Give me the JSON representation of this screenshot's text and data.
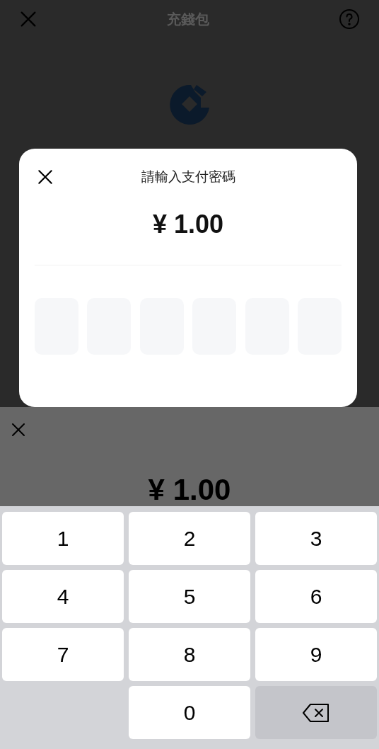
{
  "header": {
    "title": "充錢包"
  },
  "dialog": {
    "title": "請輸入支付密碼",
    "amount": "¥ 1.00",
    "pin_boxes": [
      {
        "filled": false
      },
      {
        "filled": false
      },
      {
        "filled": false
      },
      {
        "filled": false
      },
      {
        "filled": false
      },
      {
        "filled": false
      }
    ]
  },
  "sheet": {
    "amount": "¥ 1.00"
  },
  "keypad": {
    "keys": [
      {
        "kind": "digit",
        "label": "1"
      },
      {
        "kind": "digit",
        "label": "2"
      },
      {
        "kind": "digit",
        "label": "3"
      },
      {
        "kind": "digit",
        "label": "4"
      },
      {
        "kind": "digit",
        "label": "5"
      },
      {
        "kind": "digit",
        "label": "6"
      },
      {
        "kind": "digit",
        "label": "7"
      },
      {
        "kind": "digit",
        "label": "8"
      },
      {
        "kind": "digit",
        "label": "9"
      },
      {
        "kind": "blank"
      },
      {
        "kind": "digit",
        "label": "0"
      },
      {
        "kind": "backspace"
      }
    ]
  }
}
